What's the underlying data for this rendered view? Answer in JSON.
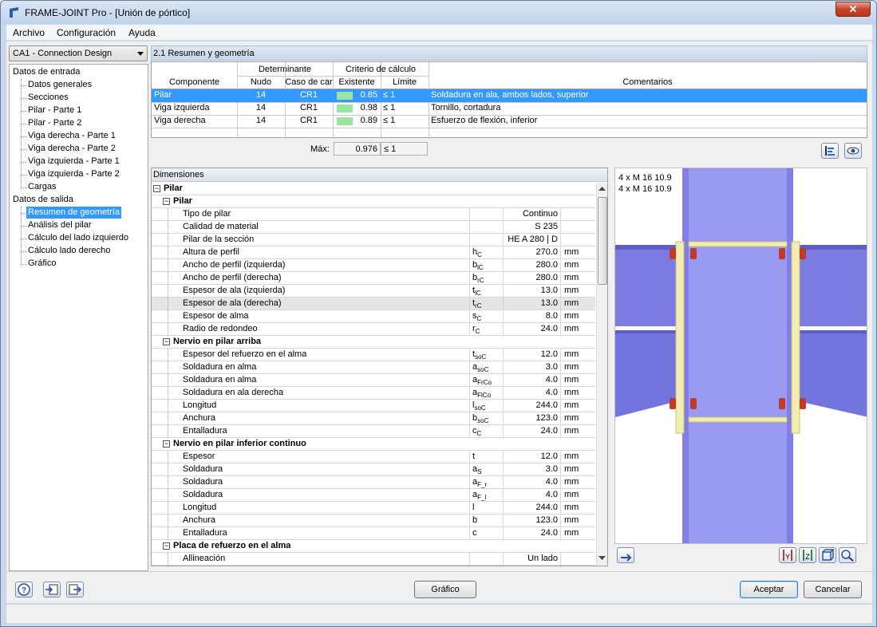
{
  "window": {
    "title": "FRAME-JOINT Pro - [Unión de pórtico]",
    "close_label": "✕"
  },
  "menu": [
    "Archivo",
    "Configuración",
    "Ayuda"
  ],
  "case_combo": "CA1 - Connection Design",
  "nav": {
    "input_root": "Datos de entrada",
    "input_items": [
      "Datos generales",
      "Secciones",
      "Pilar - Parte 1",
      "Pilar - Parte 2",
      "Viga derecha - Parte 1",
      "Viga derecha - Parte 2",
      "Viga izquierda - Parte 1",
      "Viga izquierda - Parte 2",
      "Cargas"
    ],
    "output_root": "Datos de salida",
    "output_items": [
      "Resumen de geometría",
      "Análisis del pilar",
      "Cálculo del lado izquierdo",
      "Cálculo lado derecho",
      "Gráfico"
    ],
    "selected_output": 0
  },
  "summary": {
    "title": "2.1 Resumen y geometría",
    "headers": {
      "componente": "Componente",
      "determinante": "Determinante",
      "nudo": "Nudo",
      "caso": "Caso de car",
      "criterio": "Criterio de cálculo",
      "existente": "Existente",
      "limite": "Límite",
      "comentarios": "Comentarios"
    },
    "rows": [
      {
        "componente": "Pilar",
        "nudo": "14",
        "caso": "CR1",
        "existente": "0.85",
        "limite": "≤ 1",
        "comentario": "Soldadura en ala, ambos lados, superior"
      },
      {
        "componente": "Viga izquierda",
        "nudo": "14",
        "caso": "CR1",
        "existente": "0.98",
        "limite": "≤ 1",
        "comentario": "Tornillo, cortadura"
      },
      {
        "componente": "Viga derecha",
        "nudo": "14",
        "caso": "CR1",
        "existente": "0.89",
        "limite": "≤ 1",
        "comentario": "Esfuerzo de flexión, inferior"
      }
    ],
    "max_label": "Máx:",
    "max_value": "0.976",
    "max_limit": "≤ 1"
  },
  "dims": {
    "header": "Dimensiones",
    "rows": [
      {
        "kind": "g0",
        "label": "Pilar"
      },
      {
        "kind": "g1",
        "label": "Pilar"
      },
      {
        "kind": "r",
        "label": "Tipo de pilar",
        "sym": "",
        "sub": "",
        "val": "Continuo",
        "unit": ""
      },
      {
        "kind": "r",
        "label": "Calidad de material",
        "sym": "",
        "sub": "",
        "val": "S 235",
        "unit": ""
      },
      {
        "kind": "r",
        "label": "Pilar de la sección",
        "sym": "",
        "sub": "",
        "val": "HE A 280 | D",
        "unit": ""
      },
      {
        "kind": "r",
        "label": "Altura de perfil",
        "sym": "h",
        "sub": "C",
        "val": "270.0",
        "unit": "mm"
      },
      {
        "kind": "r",
        "label": "Ancho de perfil (izquierda)",
        "sym": "b",
        "sub": "lC",
        "val": "280.0",
        "unit": "mm"
      },
      {
        "kind": "r",
        "label": "Ancho de perfil (derecha)",
        "sym": "b",
        "sub": "rC",
        "val": "280.0",
        "unit": "mm"
      },
      {
        "kind": "r",
        "label": "Espesor de ala (izquierda)",
        "sym": "t",
        "sub": "lC",
        "val": "13.0",
        "unit": "mm"
      },
      {
        "kind": "r",
        "label": "Espesor de ala (derecha)",
        "sym": "t",
        "sub": "rC",
        "val": "13.0",
        "unit": "mm",
        "alt": true
      },
      {
        "kind": "r",
        "label": "Espesor de alma",
        "sym": "s",
        "sub": "C",
        "val": "8.0",
        "unit": "mm"
      },
      {
        "kind": "r",
        "label": "Radio de redondeo",
        "sym": "r",
        "sub": "C",
        "val": "24.0",
        "unit": "mm"
      },
      {
        "kind": "g1",
        "label": "Nervio en pilar arriba"
      },
      {
        "kind": "r",
        "label": "Espesor del refuerzo en el alma",
        "sym": "t",
        "sub": "soC",
        "val": "12.0",
        "unit": "mm"
      },
      {
        "kind": "r",
        "label": "Soldadura en alma",
        "sym": "a",
        "sub": "soC",
        "val": "3.0",
        "unit": "mm"
      },
      {
        "kind": "r",
        "label": "Soldadura en alma",
        "sym": "a",
        "sub": "FrCo",
        "val": "4.0",
        "unit": "mm"
      },
      {
        "kind": "r",
        "label": "Soldadura en ala derecha",
        "sym": "a",
        "sub": "FlCo",
        "val": "4.0",
        "unit": "mm"
      },
      {
        "kind": "r",
        "label": "Longitud",
        "sym": "l",
        "sub": "soC",
        "val": "244.0",
        "unit": "mm"
      },
      {
        "kind": "r",
        "label": "Anchura",
        "sym": "b",
        "sub": "soC",
        "val": "123.0",
        "unit": "mm"
      },
      {
        "kind": "r",
        "label": "Entalladura",
        "sym": "c",
        "sub": "C",
        "val": "24.0",
        "unit": "mm"
      },
      {
        "kind": "g1",
        "label": "Nervio en pilar inferior continuo"
      },
      {
        "kind": "r",
        "label": "Espesor",
        "sym": "t",
        "sub": "",
        "val": "12.0",
        "unit": "mm"
      },
      {
        "kind": "r",
        "label": "Soldadura",
        "sym": "a",
        "sub": "S",
        "val": "3.0",
        "unit": "mm"
      },
      {
        "kind": "r",
        "label": "Soldadura",
        "sym": "a",
        "sub": "F_r",
        "val": "4.0",
        "unit": "mm"
      },
      {
        "kind": "r",
        "label": "Soldadura",
        "sym": "a",
        "sub": "F_l",
        "val": "4.0",
        "unit": "mm"
      },
      {
        "kind": "r",
        "label": "Longitud",
        "sym": "l",
        "sub": "",
        "val": "244.0",
        "unit": "mm"
      },
      {
        "kind": "r",
        "label": "Anchura",
        "sym": "b",
        "sub": "",
        "val": "123.0",
        "unit": "mm"
      },
      {
        "kind": "r",
        "label": "Entalladura",
        "sym": "c",
        "sub": "",
        "val": "24.0",
        "unit": "mm"
      },
      {
        "kind": "g1",
        "label": "Placa de refuerzo en el alma"
      },
      {
        "kind": "r",
        "label": "Allineación",
        "sym": "",
        "sub": "",
        "val": "Un lado",
        "unit": ""
      }
    ]
  },
  "graphic": {
    "bolt_label_1": "4 x M 16 10.9",
    "bolt_label_2": "4 x M 16 10.9"
  },
  "footer": {
    "grafico": "Gráfico",
    "aceptar": "Aceptar",
    "cancelar": "Cancelar"
  },
  "colors": {
    "selection": "#3399ff",
    "steel": "#8c8cf0",
    "stiffener": "#f2eeb0",
    "bolt": "#c0392b",
    "check_bar": "#9be3a0"
  }
}
